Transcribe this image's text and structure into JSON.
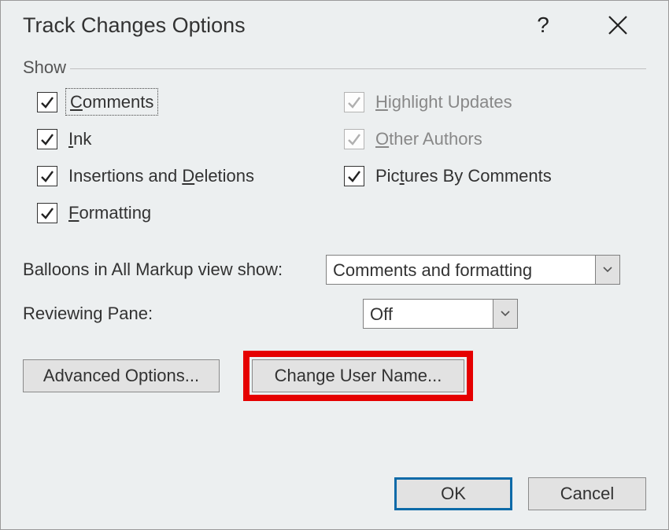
{
  "titlebar": {
    "title": "Track Changes Options"
  },
  "show": {
    "group_label": "Show",
    "left": [
      {
        "mnemonic": "C",
        "rest": "omments",
        "checked": true,
        "disabled": false,
        "focused": true,
        "name": "comments"
      },
      {
        "mnemonic": "I",
        "rest": "nk",
        "checked": true,
        "disabled": false,
        "focused": false,
        "name": "ink"
      },
      {
        "pre": "Insertions and ",
        "mnemonic": "D",
        "rest": "eletions",
        "checked": true,
        "disabled": false,
        "focused": false,
        "name": "insertions-deletions"
      },
      {
        "mnemonic": "F",
        "rest": "ormatting",
        "checked": true,
        "disabled": false,
        "focused": false,
        "name": "formatting"
      }
    ],
    "right": [
      {
        "mnemonic": "H",
        "rest": "ighlight Updates",
        "checked": true,
        "disabled": true,
        "name": "highlight-updates"
      },
      {
        "mnemonic": "O",
        "rest": "ther Authors",
        "checked": true,
        "disabled": true,
        "name": "other-authors"
      },
      {
        "pre": "Pic",
        "mnemonic": "t",
        "rest": "ures By Comments",
        "checked": true,
        "disabled": false,
        "name": "pictures-by-comments"
      }
    ]
  },
  "dropdowns": {
    "balloons_label_pre": "",
    "balloons_label_mn": "B",
    "balloons_label_rest": "alloons in All Markup view show:",
    "balloons_value": "Comments and formatting",
    "pane_label_pre": "Reviewing ",
    "pane_label_mn": "P",
    "pane_label_rest": "ane:",
    "pane_value": "Off"
  },
  "buttons": {
    "advanced_mn": "A",
    "advanced_rest": "dvanced Options...",
    "username_pre": "Change User ",
    "username_mn": "N",
    "username_rest": "ame...",
    "ok": "OK",
    "cancel": "Cancel"
  }
}
